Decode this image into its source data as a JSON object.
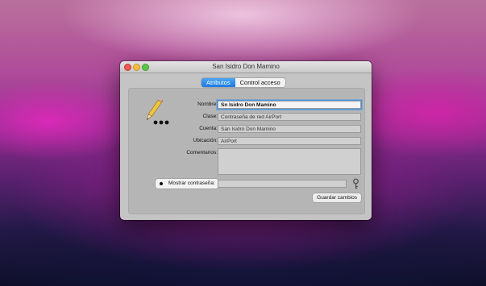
{
  "window": {
    "title": "San Isidro Don Mamino",
    "controls": [
      "close",
      "minimize",
      "zoom"
    ]
  },
  "tabs": [
    {
      "label": "Atributos",
      "selected": true
    },
    {
      "label": "Control acceso",
      "selected": false
    }
  ],
  "form": {
    "nombre": {
      "label": "Nombre:",
      "value": "Sn Isidro Don Mamino"
    },
    "clase": {
      "label": "Clase:",
      "value": "Contraseña de red AirPort"
    },
    "cuenta": {
      "label": "Cuenta:",
      "value": "San Isidro Don Mamino"
    },
    "ubicacion": {
      "label": "Ubicación:",
      "value": "AirPort"
    },
    "comentarios": {
      "label": "Comentarios:",
      "value": ""
    }
  },
  "show_password": {
    "label": "Mostrar contraseña:",
    "checked": false
  },
  "password_value": "",
  "save_button": "Guardar cambios",
  "icons": {
    "keychain_item": "pencil-password-icon",
    "key": "key-icon"
  },
  "colors": {
    "accent": "#1c7ae4",
    "focus_ring": "#4a95e0"
  }
}
